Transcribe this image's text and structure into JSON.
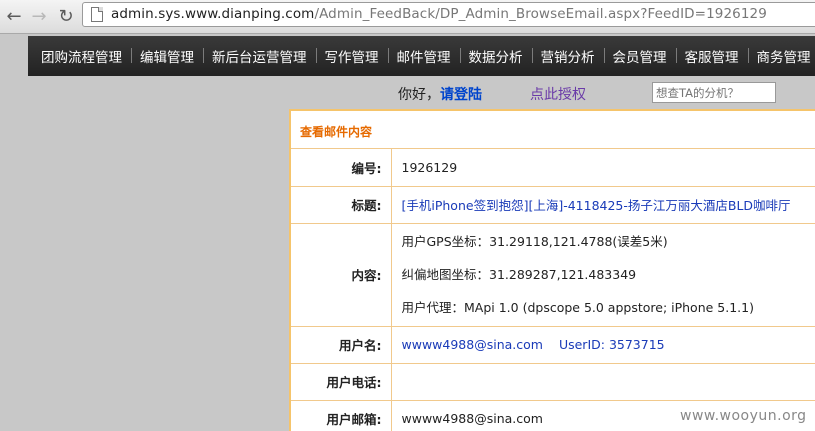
{
  "browser": {
    "url_host": "admin.sys.www.dianping.com",
    "url_path": "/Admin_FeedBack/DP_Admin_BrowseEmail.aspx?FeedID=1926129"
  },
  "menu": [
    {
      "label": "团购流程管理"
    },
    {
      "label": "编辑管理"
    },
    {
      "label": "新后台运营管理"
    },
    {
      "label": "写作管理"
    },
    {
      "label": "邮件管理"
    },
    {
      "label": "数据分析"
    },
    {
      "label": "营销分析"
    },
    {
      "label": "会员管理"
    },
    {
      "label": "客服管理"
    },
    {
      "label": "商务管理"
    }
  ],
  "greeting": {
    "hello": "你好，",
    "login": "请登陆",
    "authorize": "点此授权",
    "search_placeholder": "想查TA的分机？"
  },
  "panel": {
    "title": "查看邮件内容",
    "rows": {
      "number": {
        "label": "编号:",
        "value": "1926129"
      },
      "subject": {
        "label": "标题:",
        "value": "[手机iPhone签到抱怨][上海]-4118425-扬子江万丽大酒店BLD咖啡厅"
      },
      "content": {
        "label": "内容:",
        "lines": [
          "用户GPS坐标：31.29118,121.4788(误差5米)",
          "纠偏地图坐标：31.289287,121.483349",
          "用户代理：MApi 1.0 (dpscope 5.0 appstore; iPhone 5.1.1)"
        ]
      },
      "username": {
        "label": "用户名:",
        "email": "wwww4988@sina.com",
        "userid": "UserID: 3573715"
      },
      "phone": {
        "label": "用户电话:",
        "value": ""
      },
      "email": {
        "label": "用户邮箱:",
        "value": "wwww4988@sina.com"
      }
    }
  },
  "watermark": "www.wooyun.org"
}
